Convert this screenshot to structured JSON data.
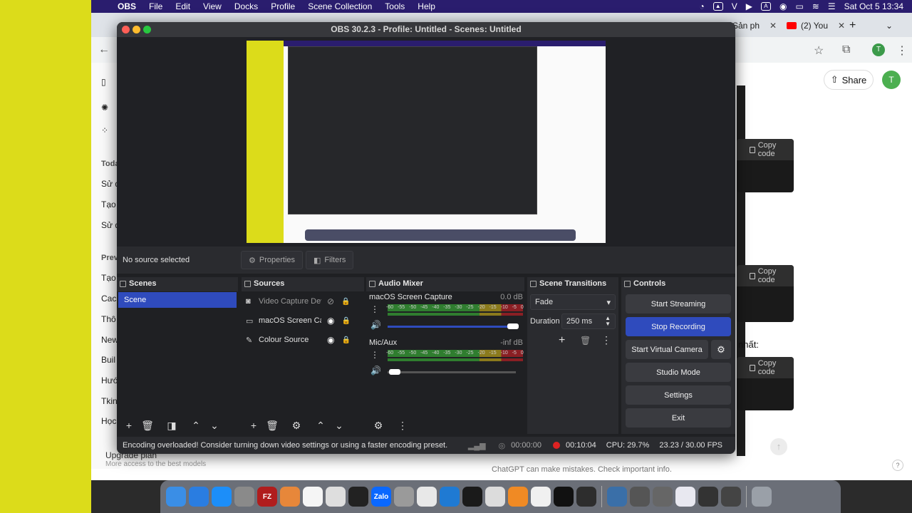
{
  "menubar": {
    "app_name": "OBS",
    "items": [
      "File",
      "Edit",
      "View",
      "Docks",
      "Profile",
      "Scene Collection",
      "Tools",
      "Help"
    ],
    "status_letters": [
      "V",
      "A"
    ],
    "clock": "Sat Oct 5  13:34"
  },
  "browser": {
    "tabs": [
      {
        "label": "Sản ph"
      },
      {
        "label": "(2) You"
      }
    ],
    "avatar_initial": "T"
  },
  "chatgpt": {
    "sidebar_fragments": [
      "Toda",
      "Sử d",
      "Tạo",
      "Sử d",
      "Prev",
      "Tạo",
      "Caci",
      "Thô",
      "New",
      "Buil",
      "Hướ",
      "Tkin",
      "Học"
    ],
    "share_label": "Share",
    "avatar_initial": "T",
    "copy_code_label": "Copy code",
    "text_fragment": "nhất:",
    "footer_note": "ChatGPT can make mistakes. Check important info.",
    "upgrade_title": "Upgrade plan",
    "upgrade_sub": "More access to the best models"
  },
  "obs": {
    "window_title": "OBS 30.2.3 - Profile: Untitled - Scenes: Untitled",
    "no_source": "No source selected",
    "properties_label": "Properties",
    "filters_label": "Filters",
    "docks": {
      "scenes": "Scenes",
      "sources": "Sources",
      "audio_mixer": "Audio Mixer",
      "scene_transitions": "Scene Transitions",
      "controls": "Controls"
    },
    "scenes": [
      "Scene"
    ],
    "sources": [
      {
        "label": "Video Capture Devi",
        "icon": "camera-icon",
        "visible": false
      },
      {
        "label": "macOS Screen Capt",
        "icon": "monitor-icon",
        "visible": true
      },
      {
        "label": "Colour Source",
        "icon": "brush-icon",
        "visible": true
      }
    ],
    "mixer": [
      {
        "name": "macOS Screen Capture",
        "db": "0.0 dB",
        "volume": 1.0
      },
      {
        "name": "Mic/Aux",
        "db": "-inf dB",
        "volume": 0.0
      }
    ],
    "meter_scale": "-60 -55 -50 -45 -40 -35 -30 -25 -20 -15 -10 -5 0",
    "transition": {
      "type": "Fade",
      "duration_label": "Duration",
      "duration_value": "250 ms"
    },
    "controls": {
      "start_streaming": "Start Streaming",
      "stop_recording": "Stop Recording",
      "start_virtual_camera": "Start Virtual Camera",
      "studio_mode": "Studio Mode",
      "settings": "Settings",
      "exit": "Exit"
    },
    "status": {
      "message": "Encoding overloaded! Consider turning down video settings or using a faster encoding preset.",
      "stream_time": "00:00:00",
      "rec_time": "00:10:04",
      "cpu": "CPU: 29.7%",
      "fps": "23.23 / 30.00 FPS"
    }
  },
  "dock_apps": [
    {
      "name": "Finder",
      "color": "#3a8ee6"
    },
    {
      "name": "Safari",
      "color": "#2a7de1"
    },
    {
      "name": "App Store",
      "color": "#1c8ef9"
    },
    {
      "name": "System Settings",
      "color": "#8a8a8a"
    },
    {
      "name": "FileZilla",
      "color": "#b01d1d",
      "text": "FZ"
    },
    {
      "name": "Launchpad",
      "color": "#e7873a"
    },
    {
      "name": "Freeform",
      "color": "#f5f5f5"
    },
    {
      "name": "Script Editor",
      "color": "#dedede"
    },
    {
      "name": "Terminal",
      "color": "#222222"
    },
    {
      "name": "Zalo",
      "color": "#0a68ff",
      "text": "Zalo"
    },
    {
      "name": "System Preferences",
      "color": "#9a9a9a"
    },
    {
      "name": "Chrome",
      "color": "#e8e8e8"
    },
    {
      "name": "VS Code",
      "color": "#1f7ad3"
    },
    {
      "name": "Activity Monitor",
      "color": "#1a1a1a"
    },
    {
      "name": "Preview",
      "color": "#dcdcdc"
    },
    {
      "name": "Books",
      "color": "#f08a24"
    },
    {
      "name": "Notes",
      "color": "#f0f0f0"
    },
    {
      "name": "CapCut",
      "color": "#111111"
    },
    {
      "name": "OBS",
      "color": "#2d2d2d"
    },
    {
      "name": "Python",
      "color": "#3a6fa8"
    },
    {
      "name": "Window 1",
      "color": "#555555"
    },
    {
      "name": "Window 2",
      "color": "#666666"
    },
    {
      "name": "Window 3",
      "color": "#e8e8f0"
    },
    {
      "name": "Window 4",
      "color": "#333333"
    },
    {
      "name": "Window 5",
      "color": "#444444"
    },
    {
      "name": "Trash",
      "color": "#9aa0a8"
    }
  ]
}
